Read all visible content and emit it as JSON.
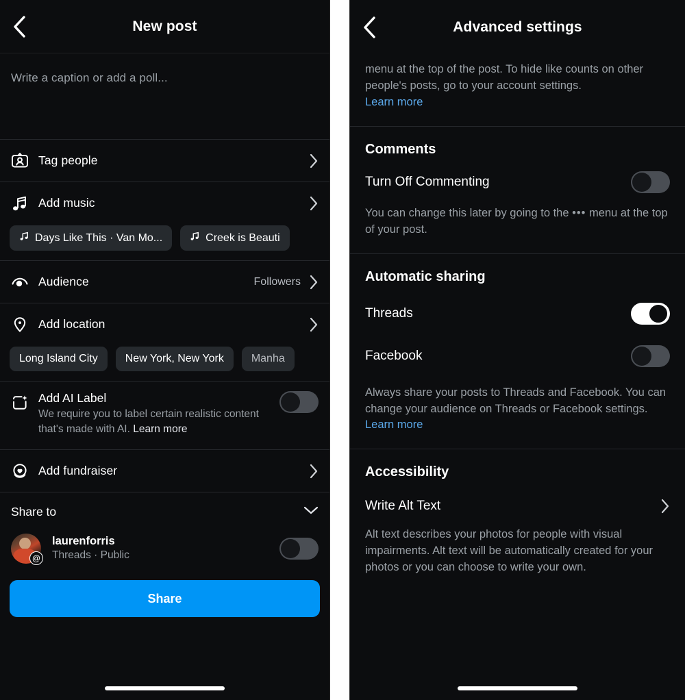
{
  "left_panel": {
    "header": {
      "title": "New post",
      "back_icon": "chevron-left-icon"
    },
    "caption": {
      "placeholder": "Write a caption or add a poll..."
    },
    "rows": {
      "tag_people": {
        "label": "Tag people",
        "icon": "tag-people-icon"
      },
      "add_music": {
        "label": "Add music",
        "icon": "music-note-icon"
      },
      "audience": {
        "label": "Audience",
        "value": "Followers",
        "icon": "audience-icon"
      },
      "add_location": {
        "label": "Add location",
        "icon": "location-pin-icon"
      },
      "add_fundraiser": {
        "label": "Add fundraiser",
        "icon": "fundraiser-heart-icon"
      }
    },
    "music_chips": [
      {
        "title": "Days Like This · Van Mo..."
      },
      {
        "title": "Creek is Beauti"
      }
    ],
    "location_chips": [
      {
        "label": "Long Island City"
      },
      {
        "label": "New York, New York"
      },
      {
        "label": "Manha"
      }
    ],
    "ai_label": {
      "title": "Add AI Label",
      "description": "We require you to label certain realistic content that's made with AI.",
      "learn_more": "Learn more",
      "toggle_state": "off",
      "icon": "ai-sparkle-icon"
    },
    "share_to": {
      "title": "Share to",
      "chevron": "chevron-down-icon",
      "account": {
        "username": "laurenforris",
        "subtitle": "Threads · Public",
        "badge_icon": "threads-icon",
        "toggle_state": "off"
      }
    },
    "share_button": {
      "label": "Share"
    }
  },
  "right_panel": {
    "header": {
      "title": "Advanced settings",
      "back_icon": "chevron-left-icon"
    },
    "intro": {
      "text": "menu at the top of the post. To hide like counts on other people's posts, go to your account settings. ",
      "link": "Learn more"
    },
    "comments": {
      "section_title": "Comments",
      "row_label": "Turn Off Commenting",
      "toggle_state": "off",
      "note_before": "You can change this later by going to the ",
      "note_dots": "•••",
      "note_after": " menu at the top of your post."
    },
    "automatic_sharing": {
      "section_title": "Automatic sharing",
      "threads": {
        "label": "Threads",
        "toggle_state": "on"
      },
      "facebook": {
        "label": "Facebook",
        "toggle_state": "off"
      },
      "note": "Always share your posts to Threads and Facebook. You can change your audience on Threads or Facebook settings. ",
      "note_link": "Learn more"
    },
    "accessibility": {
      "section_title": "Accessibility",
      "row_label": "Write Alt Text",
      "chevron": "chevron-right-icon",
      "note": "Alt text describes your photos for people with visual impairments. Alt text will be automatically created for your photos or you can choose to write your own."
    }
  },
  "colors": {
    "background": "#0c0d0f",
    "accent_blue": "#0095f6",
    "link_blue": "#5aa7e8",
    "muted_text": "#9aa0a6",
    "chip_bg": "#262a2e",
    "toggle_off_track": "#4a4e54"
  }
}
